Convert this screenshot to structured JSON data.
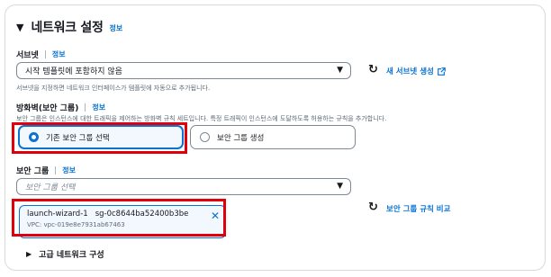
{
  "section": {
    "title": "네트워크 설정",
    "info": "정보"
  },
  "subnet": {
    "label": "서브넷",
    "info": "정보",
    "value": "시작 템플릿에 포함하지 않음",
    "description": "서브넷을 지정하면 네트워크 인터페이스가 템플릿에 자동으로 추가됩니다.",
    "new_link": "새 서브넷 생성"
  },
  "firewall": {
    "label": "방화벽(보안 그룹)",
    "info": "정보",
    "description": "보안 그룹은 인스턴스에 대한 트래픽을 제어하는 방화벽 규칙 세트입니다. 특정 트래픽이 인스턴스에 도달하도록 허용하는 규칙을 추가합니다.",
    "options": [
      {
        "label": "기존 보안 그룹 선택",
        "selected": true
      },
      {
        "label": "보안 그룹 생성",
        "selected": false
      }
    ]
  },
  "security_groups": {
    "label": "보안 그룹",
    "info": "정보",
    "placeholder": "보안 그룹 선택",
    "compare_link": "보안 그룹 규칙 비교",
    "selected": {
      "name": "launch-wizard-1",
      "id": "sg-0c8644ba52400b3be",
      "vpc": "VPC: vpc-019e8e7931ab67463"
    }
  },
  "advanced": {
    "label": "고급 네트워크 구성"
  },
  "colors": {
    "accent": "#0972d3",
    "highlight": "#e0000b"
  }
}
